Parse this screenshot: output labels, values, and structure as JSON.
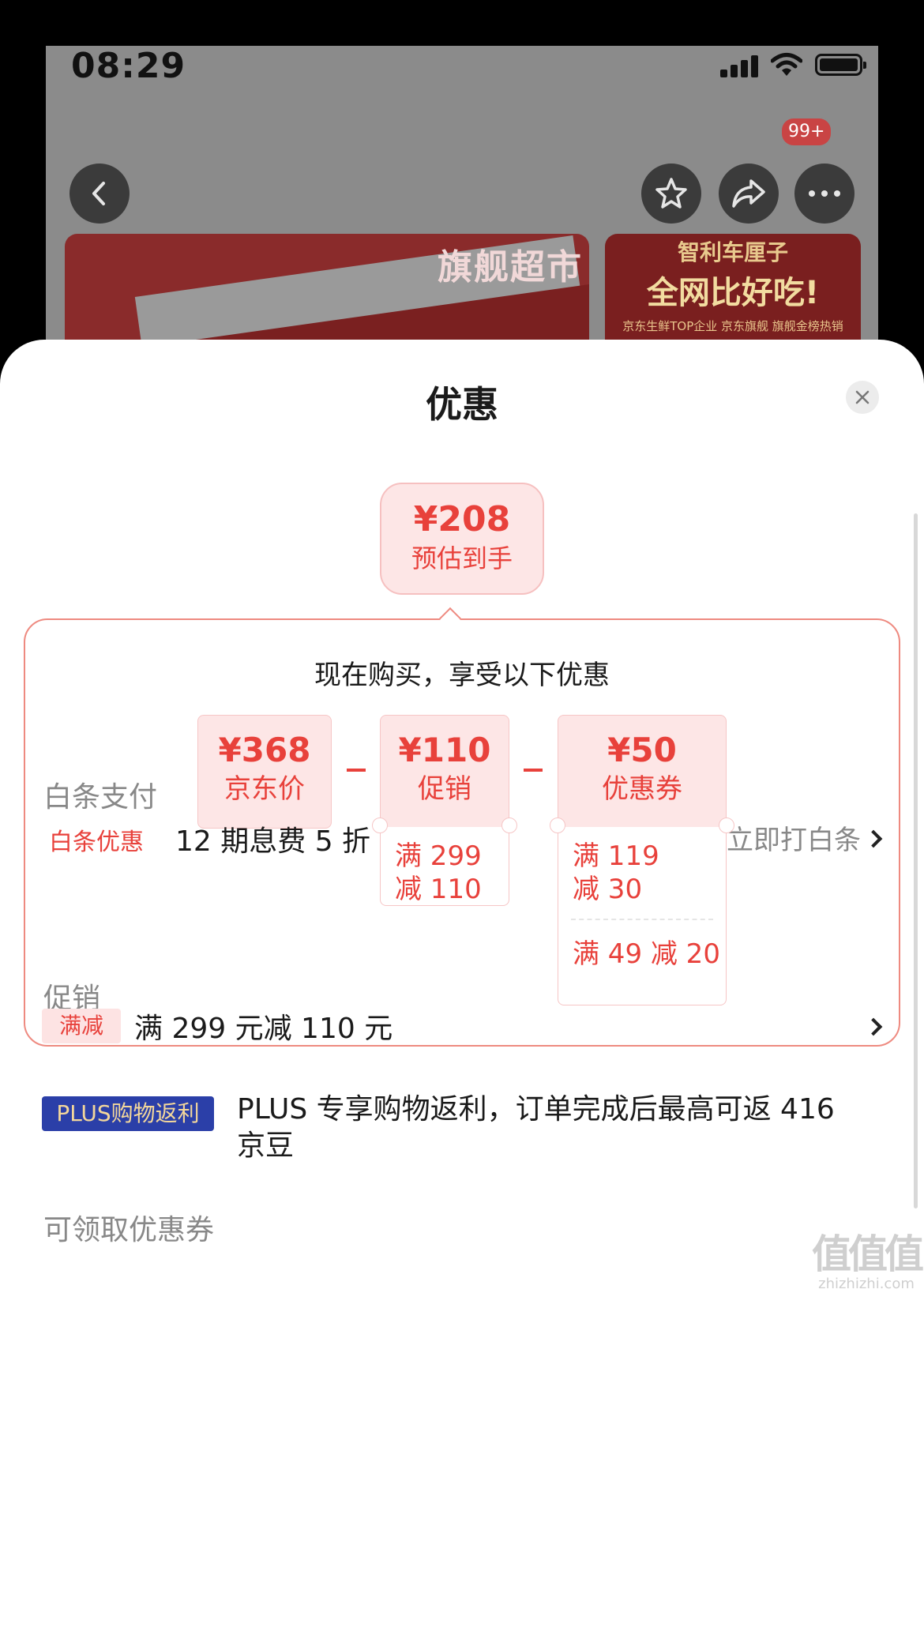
{
  "status_bar": {
    "time": "08:29"
  },
  "background": {
    "notification_badge": "99+",
    "banner_left_title": "旗舰超市",
    "banner_right_top": "智利车厘子",
    "banner_right_main": "全网比好吃!",
    "banner_right_sub": "京东生鲜TOP企业 京东旗舰 旗舰金榜热销"
  },
  "sheet": {
    "title": "优惠",
    "estimate": {
      "price": "¥208",
      "label": "预估到手"
    },
    "card_heading": "现在购买，享受以下优惠",
    "breakdown": [
      {
        "amount": "¥368",
        "label": "京东价",
        "details": []
      },
      {
        "amount": "¥110",
        "label": "促销",
        "details": [
          "满 299",
          "减 110"
        ]
      },
      {
        "amount": "¥50",
        "label": "优惠券",
        "details": [
          "满 119",
          "减 30"
        ],
        "extra": "满 49 减 20"
      }
    ],
    "baitiao": {
      "section_title": "白条支付",
      "tag": "白条优惠",
      "text": "12 期息费 5 折",
      "link": "立即打白条"
    },
    "promotion": {
      "section_title": "促销",
      "items": [
        {
          "tag": "满减",
          "text": "满 299 元减 110 元"
        },
        {
          "tag": "PLUS购物返利",
          "text": "PLUS 专享购物返利，订单完成后最高可返 416 京豆"
        }
      ]
    },
    "coupons": {
      "section_title": "可领取优惠券"
    }
  },
  "watermark": {
    "glyph": "值值值",
    "domain": "zhizhizhi.com"
  },
  "colors": {
    "accent_red": "#e8413b",
    "plus_blue": "#2b3fa8"
  }
}
